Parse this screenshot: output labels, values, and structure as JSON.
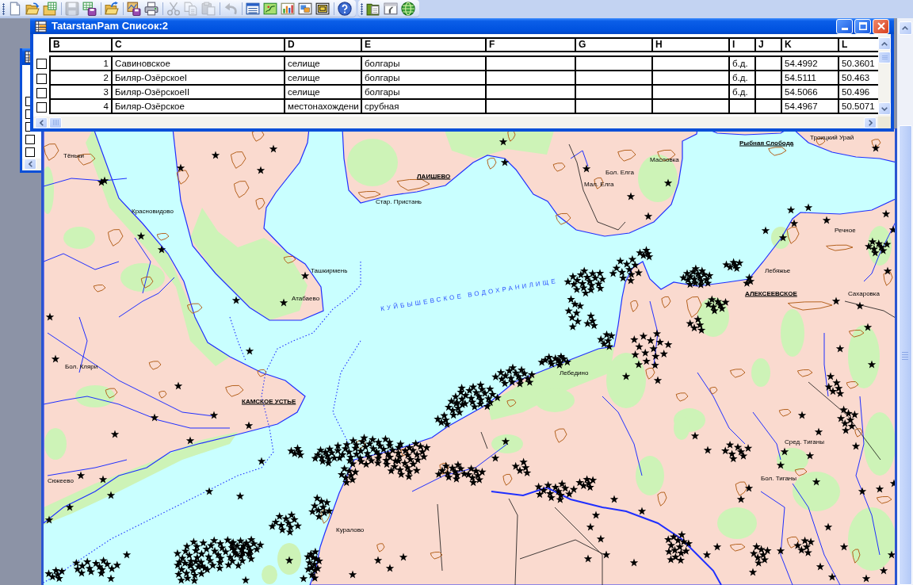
{
  "toolbars": [
    {
      "groups": [
        [
          {
            "disabled": false
          },
          {
            "disabled": false
          },
          {
            "disabled": false
          }
        ],
        [
          {
            "disabled": true
          },
          {
            "disabled": false
          }
        ],
        [
          {
            "disabled": false
          }
        ],
        [
          {
            "disabled": false
          },
          {
            "disabled": false
          }
        ],
        [
          {
            "disabled": true
          },
          {
            "disabled": true
          },
          {
            "disabled": true
          }
        ],
        [
          {
            "disabled": true
          }
        ],
        [
          {
            "disabled": false
          },
          {
            "disabled": false
          },
          {
            "disabled": false
          },
          {
            "disabled": false
          },
          {
            "disabled": false
          }
        ],
        [
          {
            "disabled": false
          }
        ]
      ]
    },
    {
      "groups": [
        [
          {
            "disabled": false
          },
          {
            "disabled": false
          },
          {
            "disabled": false
          }
        ]
      ]
    }
  ],
  "back_window": {
    "rows": [
      {
        "checked": false
      },
      {
        "checked": false
      },
      {
        "checked": false
      },
      {
        "checked": false
      },
      {
        "checked": false
      }
    ]
  },
  "browser_window": {
    "title": "TatarstanPam Список:2",
    "columns": [
      "B",
      "C",
      "D",
      "E",
      "F",
      "G",
      "H",
      "I",
      "J",
      "K",
      "L"
    ],
    "rows": [
      {
        "checked": false,
        "cells": [
          "1",
          "Савиновское",
          "селище",
          "болгары",
          null,
          null,
          null,
          "б.д.",
          null,
          "54.4992",
          "50.3601"
        ]
      },
      {
        "checked": false,
        "cells": [
          "2",
          "Биляр-ОзёрскоеI",
          "селище",
          "болгары",
          null,
          null,
          null,
          "б.д.",
          null,
          "54.5111",
          "50.463"
        ]
      },
      {
        "checked": false,
        "cells": [
          "3",
          "Биляр-ОзёрскоеII",
          "селище",
          "болгары",
          null,
          null,
          null,
          "б.д.",
          null,
          "54.5066",
          "50.496"
        ]
      },
      {
        "checked": false,
        "cells": [
          "4",
          "Биляр-Озёрское",
          "местонахождени",
          "срубная",
          null,
          null,
          null,
          null,
          null,
          "54.4967",
          "50.5071"
        ]
      }
    ]
  },
  "map_window": {
    "labels": [
      {
        "text": "Тёньки",
        "kind": "town"
      },
      {
        "text": "Красновидово",
        "kind": "town"
      },
      {
        "text": "Ташкирмень",
        "kind": "town"
      },
      {
        "text": "Атабаево",
        "kind": "town"
      },
      {
        "text": "Бол. Кляри",
        "kind": "town"
      },
      {
        "text": "КАМСКОЕ УСТЬЕ",
        "kind": "center"
      },
      {
        "text": "ЛАИШЕВО",
        "kind": "center"
      },
      {
        "text": "Стар. Пристань",
        "kind": "town"
      },
      {
        "text": "Мал. Елга",
        "kind": "town"
      },
      {
        "text": "Бол. Елга",
        "kind": "town"
      },
      {
        "text": "Масловка",
        "kind": "town"
      },
      {
        "text": "Рыбная Слобода",
        "kind": "center"
      },
      {
        "text": "Троицкий Урай",
        "kind": "town"
      },
      {
        "text": "КУЙБЫШЕВСКОЕ ВОДОХРАНИЛИЩЕ",
        "kind": "water"
      },
      {
        "text": "Речное",
        "kind": "town"
      },
      {
        "text": "Лебяжье",
        "kind": "town"
      },
      {
        "text": "АЛЕКСЕЕВСКОЕ",
        "kind": "center"
      },
      {
        "text": "Сахаровка",
        "kind": "town"
      },
      {
        "text": "Лебедино",
        "kind": "town"
      },
      {
        "text": "Сред. Тиганы",
        "kind": "town"
      },
      {
        "text": "Бол. Тиганы",
        "kind": "town"
      },
      {
        "text": "Сюкеево",
        "kind": "town"
      },
      {
        "text": "Куралово",
        "kind": "town"
      }
    ]
  }
}
